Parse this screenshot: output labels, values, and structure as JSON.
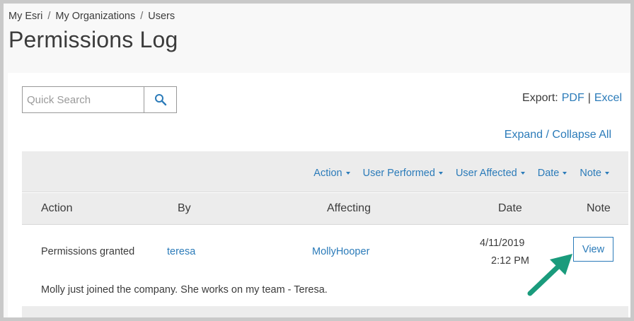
{
  "breadcrumb": [
    "My Esri",
    "My Organizations",
    "Users"
  ],
  "breadcrumb_sep": "/",
  "page_title": "Permissions Log",
  "search": {
    "placeholder": "Quick Search",
    "icon": "search-icon"
  },
  "export": {
    "label": "Export:",
    "pdf": "PDF",
    "sep": "|",
    "excel": "Excel"
  },
  "expand_collapse": "Expand / Collapse All",
  "filters": [
    "Action",
    "User Performed",
    "User Affected",
    "Date",
    "Note"
  ],
  "columns": {
    "action": "Action",
    "by": "By",
    "affecting": "Affecting",
    "date": "Date",
    "note": "Note"
  },
  "rows": [
    {
      "action": "Permissions granted",
      "by": "teresa",
      "affecting": "MollyHooper",
      "date": "4/11/2019",
      "time": "2:12 PM",
      "note_button": "View",
      "note_text": "Molly just joined the company. She works on my team - Teresa."
    }
  ],
  "colors": {
    "link": "#2b7bb9",
    "header_bg": "#ececec",
    "arrow": "#1a9b7c",
    "text": "#3b3b3b"
  }
}
